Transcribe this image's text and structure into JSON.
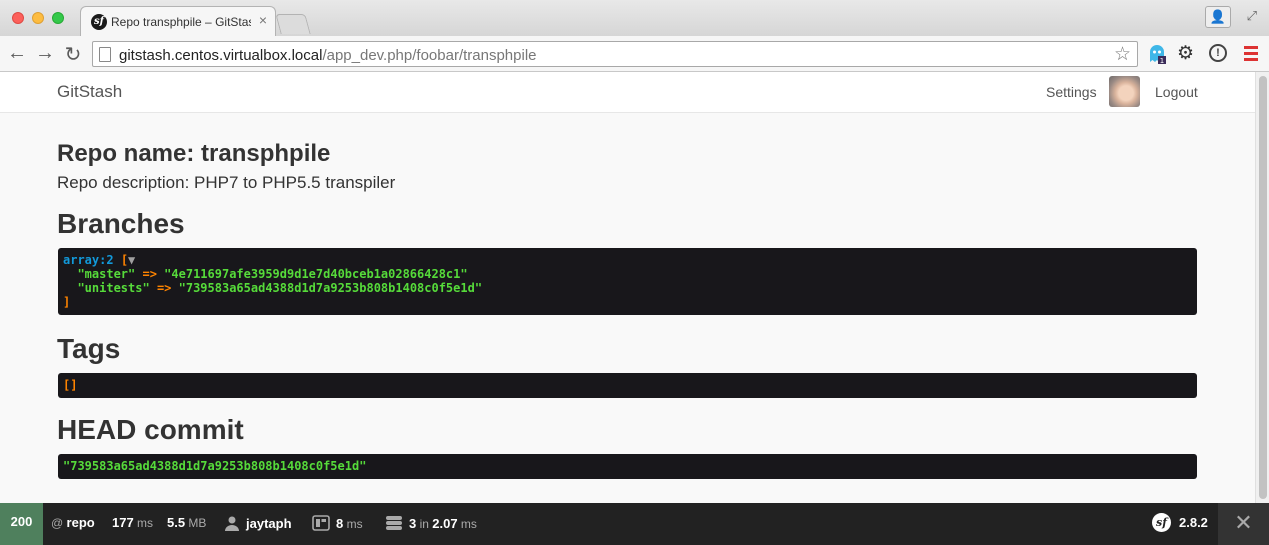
{
  "browser": {
    "tab_title": "Repo transphpile – GitStash",
    "tab_close": "×",
    "favicon": "sf",
    "url_host": "gitstash.centos.virtualbox.local",
    "url_path": "/app_dev.php/foobar/transphpile",
    "icons": [
      "back-arrow-icon",
      "forward-arrow-icon",
      "reload-icon",
      "page-icon",
      "star-icon",
      "ghostery-icon",
      "gear-icon",
      "info-icon",
      "menu-icon"
    ],
    "ext_badge": "1"
  },
  "navbar": {
    "brand": "GitStash",
    "settings": "Settings",
    "logout": "Logout"
  },
  "repo": {
    "name_heading": "Repo name: transphpile",
    "description": "Repo description: PHP7 to PHP5.5 transpiler"
  },
  "sections": {
    "branches": "Branches",
    "tags": "Tags",
    "head_commit": "HEAD commit"
  },
  "branches_dump": {
    "type": "array:2",
    "open": "[",
    "toggle": "▼",
    "close": "]",
    "arrow": "=>",
    "entries": [
      {
        "key": "\"master\"",
        "value": "\"4e711697afe3959d9d1e7d40bceb1a02866428c1\""
      },
      {
        "key": "\"unitests\"",
        "value": "\"739583a65ad4388d1d7a9253b808b1408c0f5e1d\""
      }
    ]
  },
  "tags_dump": "[]",
  "head_commit_dump": "\"739583a65ad4388d1d7a9253b808b1408c0f5e1d\"",
  "symfony_toolbar": {
    "status_code": "200",
    "route_prefix": "@",
    "route": "repo",
    "time_value": "177",
    "time_unit": "ms",
    "memory_value": "5.5",
    "memory_unit": "MB",
    "user": "jaytaph",
    "twig_value": "8",
    "twig_unit": "ms",
    "db_queries": "3",
    "db_in": "in",
    "db_time": "2.07",
    "db_unit": "ms",
    "version": "2.8.2",
    "close": "✕",
    "colors": {
      "status_ok": "#4f805d",
      "bar_bg": "#222222"
    }
  }
}
